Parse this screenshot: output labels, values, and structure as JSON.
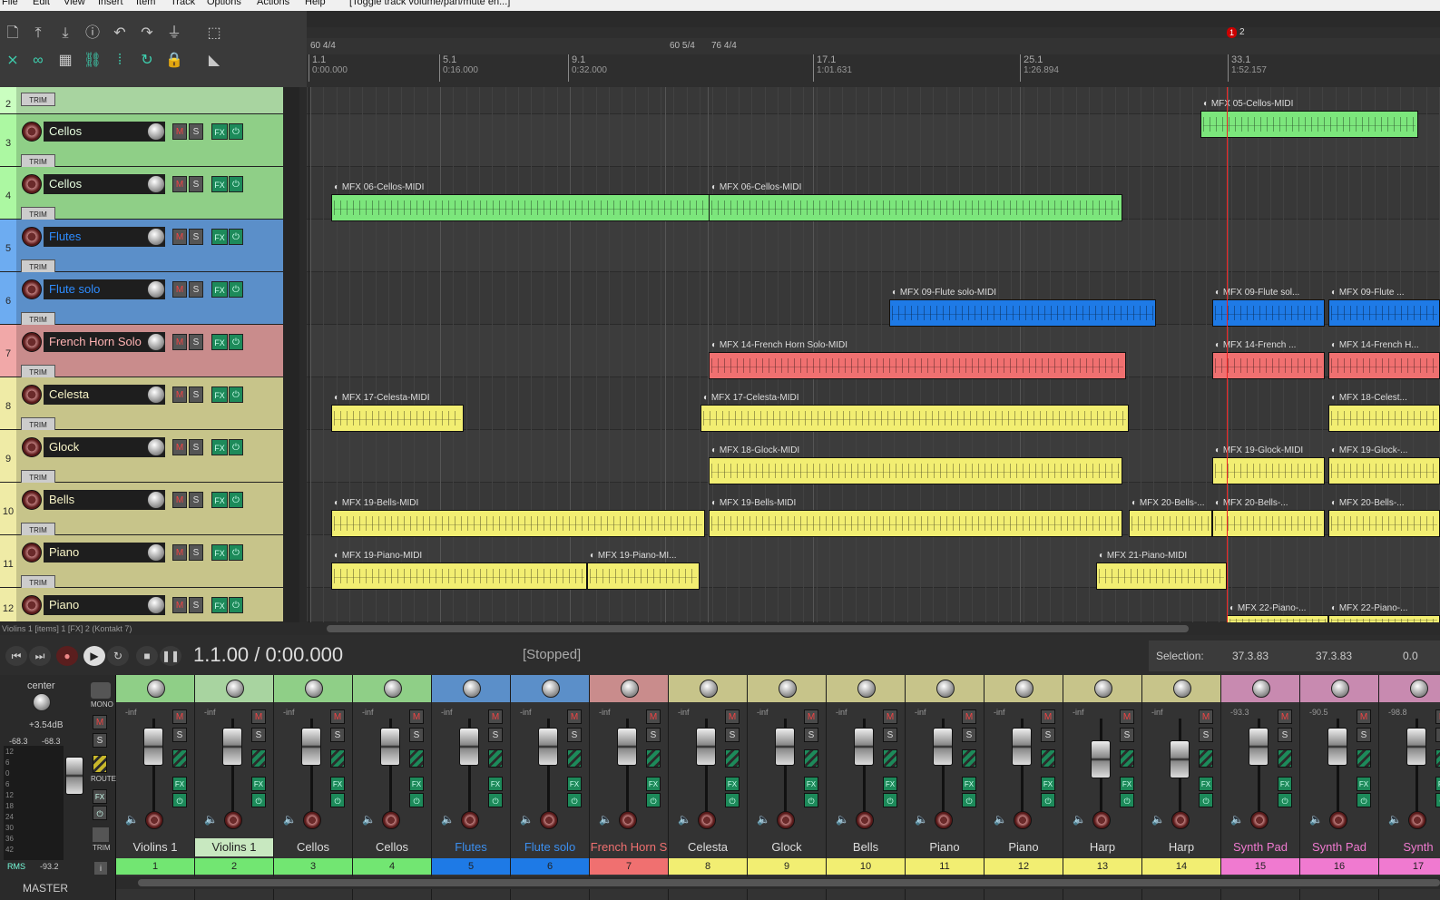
{
  "menu": {
    "items": [
      "File",
      "Edit",
      "View",
      "Insert",
      "Item",
      "Track",
      "Options",
      "Actions",
      "Help"
    ],
    "hint": "[Toggle track volume/pan/mute en...]"
  },
  "ruler": {
    "tempo_markers": [
      "60 4/4",
      "60 5/4",
      "76 4/4"
    ],
    "bars": [
      {
        "bar": "1.1",
        "time": "0:00.000"
      },
      {
        "bar": "5.1",
        "time": "0:16.000"
      },
      {
        "bar": "9.1",
        "time": "0:32.000"
      },
      {
        "bar": "17.1",
        "time": "1:01.631"
      },
      {
        "bar": "25.1",
        "time": "1:26.894"
      },
      {
        "bar": "33.1",
        "time": "1:52.157"
      }
    ],
    "marker": {
      "number": "1",
      "label": "2"
    }
  },
  "tracks": [
    {
      "num": "2",
      "name": "",
      "color": "#a8d4a0",
      "height": 30
    },
    {
      "num": "3",
      "name": "Cellos",
      "color": "#8fcf87",
      "height": 58
    },
    {
      "num": "4",
      "name": "Cellos",
      "color": "#8fcf87",
      "height": 58
    },
    {
      "num": "5",
      "name": "Flutes",
      "color": "#5b8fc9",
      "height": 58
    },
    {
      "num": "6",
      "name": "Flute solo",
      "color": "#5b8fc9",
      "height": 58
    },
    {
      "num": "7",
      "name": "French Horn Solo",
      "color": "#c98c8c",
      "height": 58
    },
    {
      "num": "8",
      "name": "Celesta",
      "color": "#c7c48a",
      "height": 58
    },
    {
      "num": "9",
      "name": "Glock",
      "color": "#c7c48a",
      "height": 58
    },
    {
      "num": "10",
      "name": "Bells",
      "color": "#c7c48a",
      "height": 58
    },
    {
      "num": "11",
      "name": "Piano",
      "color": "#c7c48a",
      "height": 58
    },
    {
      "num": "12",
      "name": "Piano",
      "color": "#c7c48a",
      "height": 38
    }
  ],
  "labels": {
    "trim": "TRIM",
    "m": "M",
    "s": "S",
    "fx": "FX",
    "pow": "⏻"
  },
  "items": [
    {
      "lane": 1,
      "name": "05-Cellos-MIDI",
      "color": "#7ce67c"
    },
    {
      "lane": 2,
      "name": "06-Cellos-MIDI",
      "color": "#7ce67c"
    },
    {
      "lane": 2,
      "name": "06-Cellos-MIDI",
      "color": "#7ce67c"
    },
    {
      "lane": 4,
      "name": "09-Flute solo-MIDI",
      "color": "#1e7ae6"
    },
    {
      "lane": 4,
      "name": "09-Flute sol...",
      "color": "#1e7ae6"
    },
    {
      "lane": 4,
      "name": "09-Flute ...",
      "color": "#1e7ae6"
    },
    {
      "lane": 5,
      "name": "14-French Horn Solo-MIDI",
      "color": "#f07070"
    },
    {
      "lane": 5,
      "name": "14-French ...",
      "color": "#f07070"
    },
    {
      "lane": 5,
      "name": "14-French H...",
      "color": "#f07070"
    },
    {
      "lane": 6,
      "name": "17-Celesta-MIDI",
      "color": "#f2ee72"
    },
    {
      "lane": 6,
      "name": "17-Celesta-MIDI",
      "color": "#f2ee72"
    },
    {
      "lane": 6,
      "name": "18-Celest...",
      "color": "#f2ee72"
    },
    {
      "lane": 7,
      "name": "18-Glock-MIDI",
      "color": "#f2ee72"
    },
    {
      "lane": 7,
      "name": "19-Glock-MIDI",
      "color": "#f2ee72"
    },
    {
      "lane": 7,
      "name": "19-Glock-...",
      "color": "#f2ee72"
    },
    {
      "lane": 8,
      "name": "19-Bells-MIDI",
      "color": "#f2ee72"
    },
    {
      "lane": 8,
      "name": "19-Bells-MIDI",
      "color": "#f2ee72"
    },
    {
      "lane": 8,
      "name": "20-Bells-...",
      "color": "#f2ee72"
    },
    {
      "lane": 8,
      "name": "20-Bells-...",
      "color": "#f2ee72"
    },
    {
      "lane": 8,
      "name": "20-Bells-...",
      "color": "#f2ee72"
    },
    {
      "lane": 9,
      "name": "19-Piano-MIDI",
      "color": "#f2ee72"
    },
    {
      "lane": 9,
      "name": "19-Piano-MI...",
      "color": "#f2ee72"
    },
    {
      "lane": 9,
      "name": "21-Piano-MIDI",
      "color": "#f2ee72"
    },
    {
      "lane": 10,
      "name": "22-Piano-...",
      "color": "#f2ee72"
    },
    {
      "lane": 10,
      "name": "22-Piano-...",
      "color": "#f2ee72"
    }
  ],
  "status": {
    "line": "Violins 1 [items] 1 [FX] 2 (Kontakt 7)"
  },
  "transport": {
    "position": "1.1.00 / 0:00.000",
    "state": "[Stopped]",
    "selection_label": "Selection:",
    "sel_start": "37.3.83",
    "sel_end": "37.3.83",
    "sel_len": "0.0"
  },
  "master": {
    "pan": "center",
    "peak": "+3.54dB",
    "left": "-68.3",
    "right": "-68.3",
    "rms_label": "RMS",
    "rms": "-93.2",
    "name": "MASTER",
    "mono": "MONO",
    "route": "ROUTE",
    "scale": [
      "12",
      "6",
      "0",
      "6",
      "12",
      "18",
      "24",
      "30",
      "36",
      "42"
    ]
  },
  "mixer": [
    {
      "name": "Violins 1",
      "num": "1",
      "vol": "-inf",
      "color": "#8fcf87",
      "numcolor": "#72e672",
      "text": "#ddd",
      "selected": false
    },
    {
      "name": "Violins 1",
      "num": "2",
      "vol": "-inf",
      "color": "#a8d4a0",
      "numcolor": "#72e672",
      "text": "#222",
      "selected": true
    },
    {
      "name": "Cellos",
      "num": "3",
      "vol": "-inf",
      "color": "#8fcf87",
      "numcolor": "#72e672",
      "text": "#ddd",
      "selected": false
    },
    {
      "name": "Cellos",
      "num": "4",
      "vol": "-inf",
      "color": "#8fcf87",
      "numcolor": "#72e672",
      "text": "#ddd",
      "selected": false
    },
    {
      "name": "Flutes",
      "num": "5",
      "vol": "-inf",
      "color": "#5b8fc9",
      "numcolor": "#1e7ae6",
      "text": "#3b8ff0",
      "selected": false
    },
    {
      "name": "Flute solo",
      "num": "6",
      "vol": "-inf",
      "color": "#5b8fc9",
      "numcolor": "#1e7ae6",
      "text": "#3b8ff0",
      "selected": false
    },
    {
      "name": "French Horn S",
      "num": "7",
      "vol": "-inf",
      "color": "#c98c8c",
      "numcolor": "#f07070",
      "text": "#f07070",
      "selected": false
    },
    {
      "name": "Celesta",
      "num": "8",
      "vol": "-inf",
      "color": "#c7c48a",
      "numcolor": "#f2ee72",
      "text": "#ddd",
      "selected": false
    },
    {
      "name": "Glock",
      "num": "9",
      "vol": "-inf",
      "color": "#c7c48a",
      "numcolor": "#f2ee72",
      "text": "#ddd",
      "selected": false
    },
    {
      "name": "Bells",
      "num": "10",
      "vol": "-inf",
      "color": "#c7c48a",
      "numcolor": "#f2ee72",
      "text": "#ddd",
      "selected": false
    },
    {
      "name": "Piano",
      "num": "11",
      "vol": "-inf",
      "color": "#c7c48a",
      "numcolor": "#f2ee72",
      "text": "#ddd",
      "selected": false
    },
    {
      "name": "Piano",
      "num": "12",
      "vol": "-inf",
      "color": "#c7c48a",
      "numcolor": "#f2ee72",
      "text": "#ddd",
      "selected": false
    },
    {
      "name": "Harp",
      "num": "13",
      "vol": "-inf",
      "color": "#c7c48a",
      "numcolor": "#f2ee72",
      "text": "#ddd",
      "selected": false
    },
    {
      "name": "Harp",
      "num": "14",
      "vol": "-inf",
      "color": "#c7c48a",
      "numcolor": "#f2ee72",
      "text": "#ddd",
      "selected": false
    },
    {
      "name": "Synth Pad",
      "num": "15",
      "vol": "-93.3",
      "color": "#c88ab0",
      "numcolor": "#f07ad0",
      "text": "#f07ad0",
      "selected": false
    },
    {
      "name": "Synth Pad",
      "num": "16",
      "vol": "-90.5",
      "color": "#c88ab0",
      "numcolor": "#f07ad0",
      "text": "#f07ad0",
      "selected": false
    },
    {
      "name": "Synth",
      "num": "17",
      "vol": "-98.8",
      "color": "#c88ab0",
      "numcolor": "#f07ad0",
      "text": "#f07ad0",
      "selected": false
    }
  ]
}
